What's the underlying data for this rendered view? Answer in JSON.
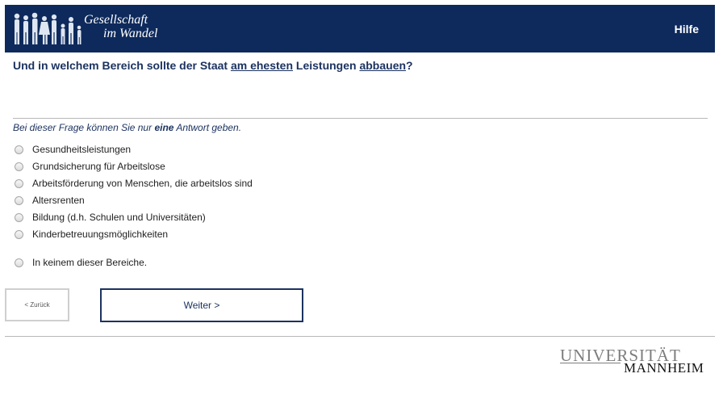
{
  "header": {
    "logo_line1": "Gesellschaft",
    "logo_line2": "im Wandel",
    "help_label": "Hilfe",
    "background_color": "#0e2a5c"
  },
  "question": {
    "part1": "Und in welchem Bereich sollte der Staat ",
    "underlined1": "am ehesten",
    "part2": " Leistungen ",
    "underlined2": "abbauen",
    "part3": "?"
  },
  "hint": {
    "before": "Bei dieser Frage können Sie nur ",
    "bold": "eine",
    "after": " Antwort geben."
  },
  "options": [
    {
      "label": "Gesundheitsleistungen",
      "selected": false
    },
    {
      "label": "Grundsicherung für Arbeitslose",
      "selected": false
    },
    {
      "label": "Arbeitsförderung von Menschen, die arbeitslos sind",
      "selected": false
    },
    {
      "label": "Altersrenten",
      "selected": false
    },
    {
      "label": "Bildung (d.h. Schulen und Universitäten)",
      "selected": false
    },
    {
      "label": "Kinderbetreuungsmöglichkeiten",
      "selected": false
    },
    {
      "label": "In keinem dieser Bereiche.",
      "selected": false
    }
  ],
  "nav": {
    "back_label": "< Zurück",
    "next_label": "Weiter >"
  },
  "footer": {
    "uni_line1": "UNIVERSITÄT",
    "uni_line2": "MANNHEIM"
  }
}
